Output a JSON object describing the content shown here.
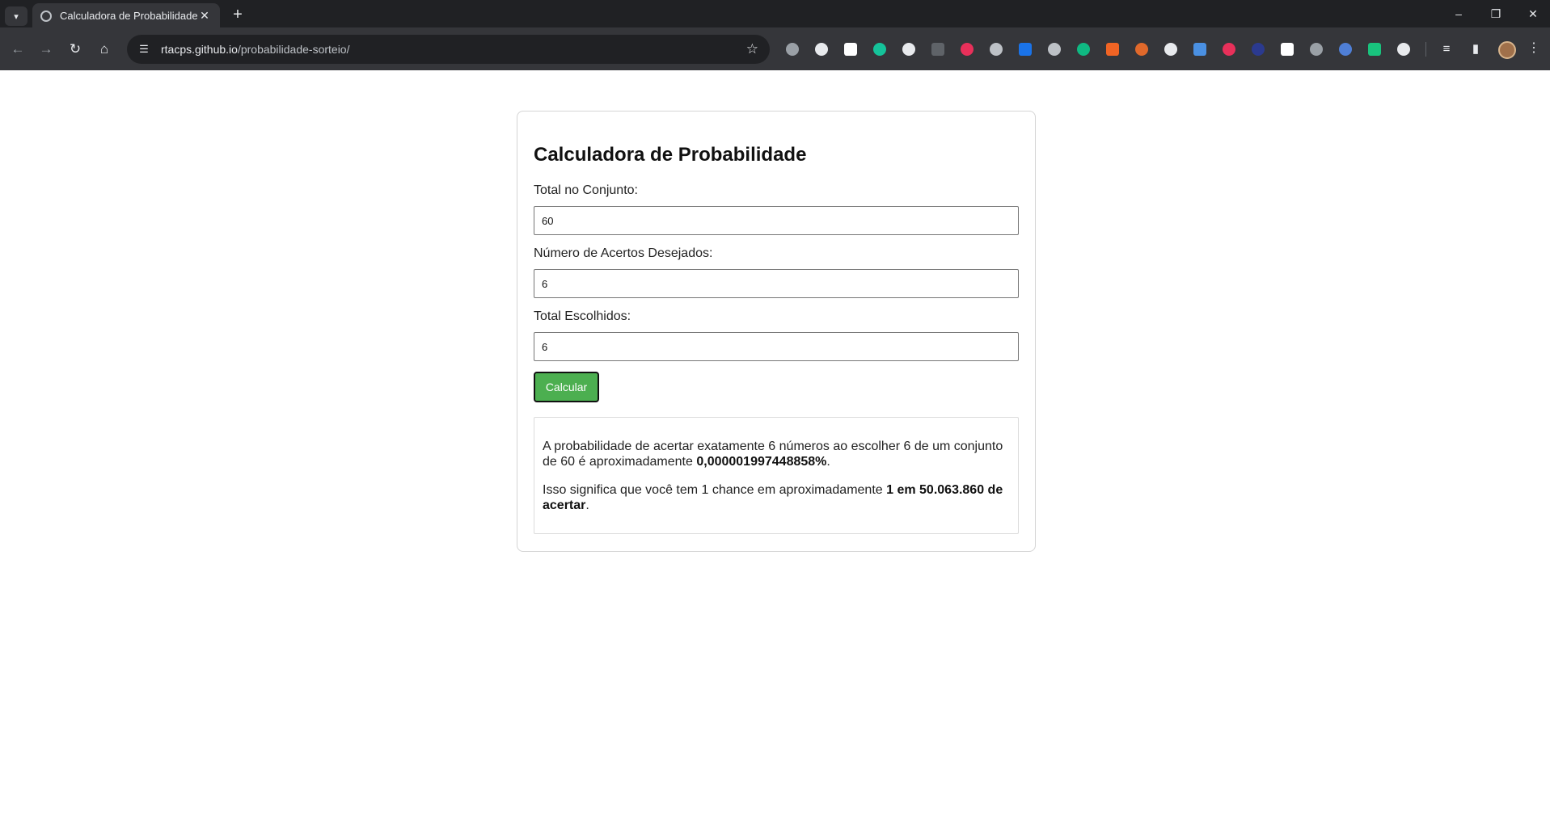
{
  "browser": {
    "tab_title": "Calculadora de Probabilidade",
    "url_host": "rtacps.github.io",
    "url_path": "/probabilidade-sorteio/"
  },
  "page": {
    "title": "Calculadora de Probabilidade",
    "fields": [
      {
        "label": "Total no Conjunto:",
        "value": "60"
      },
      {
        "label": "Número de Acertos Desejados:",
        "value": "6"
      },
      {
        "label": "Total Escolhidos:",
        "value": "6"
      }
    ],
    "button_label": "Calcular",
    "result": {
      "line1_pre": "A probabilidade de acertar exatamente 6 números ao escolher 6 de um conjunto de 60 é aproximadamente ",
      "line1_value": "0,000001997448858%",
      "line1_post": ".",
      "line2_pre": "Isso significa que você tem 1 chance em aproximadamente ",
      "line2_value": "1 em 50.063.860 de acertar",
      "line2_post": "."
    },
    "accent_color": "#4caf50"
  },
  "extensions": [
    {
      "name": "shield-ext-icon",
      "color": "#9aa0a6"
    },
    {
      "name": "pen-ext-icon",
      "color": "#e8eaed"
    },
    {
      "name": "b-ext-icon",
      "color": "#ffffff"
    },
    {
      "name": "grammarly-ext-icon",
      "color": "#15c39a"
    },
    {
      "name": "formula-ext-icon",
      "color": "#e8eaed"
    },
    {
      "name": "play-ext-icon",
      "color": "#5f6368"
    },
    {
      "name": "red-ext-icon",
      "color": "#e8305a"
    },
    {
      "name": "swirl-ext-icon",
      "color": "#bdc1c6"
    },
    {
      "name": "blue-b-ext-icon",
      "color": "#1a73e8"
    },
    {
      "name": "camera-ext-icon",
      "color": "#bdc1c6"
    },
    {
      "name": "green-flag-ext-icon",
      "color": "#0fb982"
    },
    {
      "name": "orange-ext-icon",
      "color": "#f06424"
    },
    {
      "name": "b-circle-ext-icon",
      "color": "#e0692b"
    },
    {
      "name": "plus-circle-ext-icon",
      "color": "#e8eaed"
    },
    {
      "name": "blue-grid-ext-icon",
      "color": "#4a90e2"
    },
    {
      "name": "ring-ext-icon",
      "color": "#e8305a"
    },
    {
      "name": "navy-ext-icon",
      "color": "#2b3a8f"
    },
    {
      "name": "off-ext-icon",
      "color": "#ffffff"
    },
    {
      "name": "mouse-ext-icon",
      "color": "#9aa0a6"
    },
    {
      "name": "blue-shield-ext-icon",
      "color": "#4f7fd6"
    },
    {
      "name": "green-hex-ext-icon",
      "color": "#19c37d"
    },
    {
      "name": "puzzle-ext-icon",
      "color": "#e8eaed"
    }
  ]
}
